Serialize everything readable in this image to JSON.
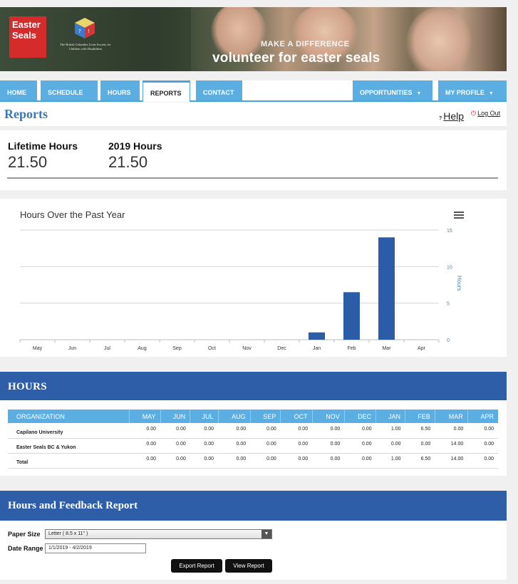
{
  "banner": {
    "logo_line1": "Easter",
    "logo_line2": "Seals",
    "society_text": "The British Columbia Lions Society for Children with Disabilities",
    "tagline_top": "MAKE A DIFFERENCE",
    "tagline_main": "volunteer for easter seals"
  },
  "nav": {
    "tabs": [
      {
        "label": "HOME"
      },
      {
        "label": "SCHEDULE"
      },
      {
        "label": "HOURS"
      },
      {
        "label": "REPORTS"
      },
      {
        "label": "CONTACT"
      }
    ],
    "right_tabs": [
      {
        "label": "OPPORTUNITIES"
      },
      {
        "label": "MY PROFILE"
      }
    ],
    "active": "REPORTS"
  },
  "header": {
    "title": "Reports",
    "help_icon": "?",
    "help_label": "Help",
    "logout_label": "Log Out",
    "logout_icon": "power-icon"
  },
  "stats": {
    "lifetime_label": "Lifetime Hours",
    "lifetime_value": "21.50",
    "year_label": "2019 Hours",
    "year_value": "21.50"
  },
  "chart_data": {
    "type": "bar",
    "title": "Hours Over the Past Year",
    "ylabel": "Hours",
    "xlabel": "",
    "categories": [
      "May",
      "Jun",
      "Jul",
      "Aug",
      "Sep",
      "Oct",
      "Nov",
      "Dec",
      "Jan",
      "Feb",
      "Mar",
      "Apr"
    ],
    "values": [
      0,
      0,
      0,
      0,
      0,
      0,
      0,
      0,
      1,
      6.5,
      14,
      0
    ],
    "ylim": [
      0,
      15
    ],
    "yticks": [
      0,
      5,
      10,
      15
    ],
    "y_axis_position": "right",
    "grid": true,
    "bar_color": "#2b5ca8"
  },
  "hours": {
    "title": "HOURS",
    "columns": [
      "ORGANIZATION",
      "MAY",
      "JUN",
      "JUL",
      "AUG",
      "SEP",
      "OCT",
      "NOV",
      "DEC",
      "JAN",
      "FEB",
      "MAR",
      "APR"
    ],
    "rows": [
      [
        "Capilano University",
        "0.00",
        "0.00",
        "0.00",
        "0.00",
        "0.00",
        "0.00",
        "0.00",
        "0.00",
        "1.00",
        "6.50",
        "0.00",
        "0.00"
      ],
      [
        "Easter Seals BC & Yukon",
        "0.00",
        "0.00",
        "0.00",
        "0.00",
        "0.00",
        "0.00",
        "0.00",
        "0.00",
        "0.00",
        "0.00",
        "14.00",
        "0.00"
      ],
      [
        "Total",
        "0.00",
        "0.00",
        "0.00",
        "0.00",
        "0.00",
        "0.00",
        "0.00",
        "0.00",
        "1.00",
        "6.50",
        "14.00",
        "0.00"
      ]
    ]
  },
  "report": {
    "title": "Hours and Feedback Report",
    "paper_size_label": "Paper Size",
    "paper_size_value": "Letter ( 8.5 x 11\" )",
    "date_range_label": "Date Range",
    "date_range_value": "1/1/2019 - 4/2/2019",
    "export_label": "Export Report",
    "view_label": "View Report"
  },
  "colors": {
    "nav_blue": "#5aaee2",
    "section_blue": "#2e5ea8",
    "title_blue": "#3a78b6"
  }
}
